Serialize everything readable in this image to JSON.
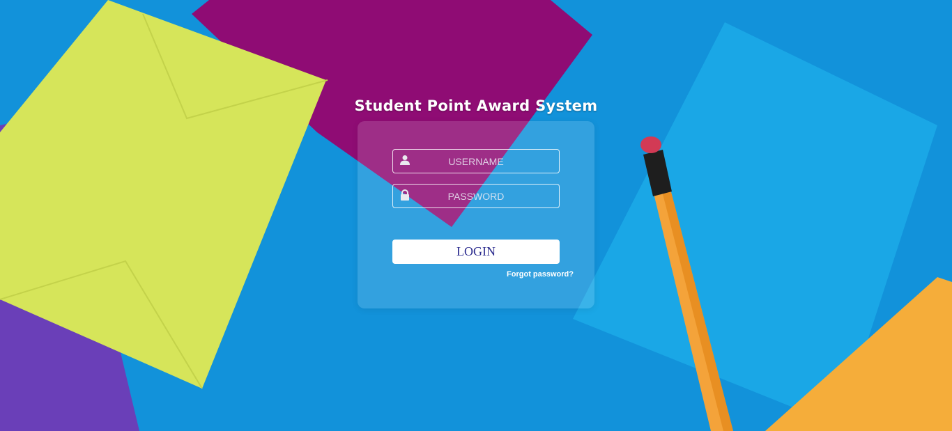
{
  "app_title": "Student Point Award System",
  "login_form": {
    "username_placeholder": "USERNAME",
    "password_placeholder": "PASSWORD",
    "username_icon": "user-icon",
    "password_icon": "lock-icon",
    "login_label": "LOGIN",
    "forgot_password_label": "Forgot password?"
  },
  "colors": {
    "background_blue": "#0f8fd8",
    "login_text": "#2b2b8e",
    "card_overlay": "rgba(255,255,255,0.14)"
  }
}
